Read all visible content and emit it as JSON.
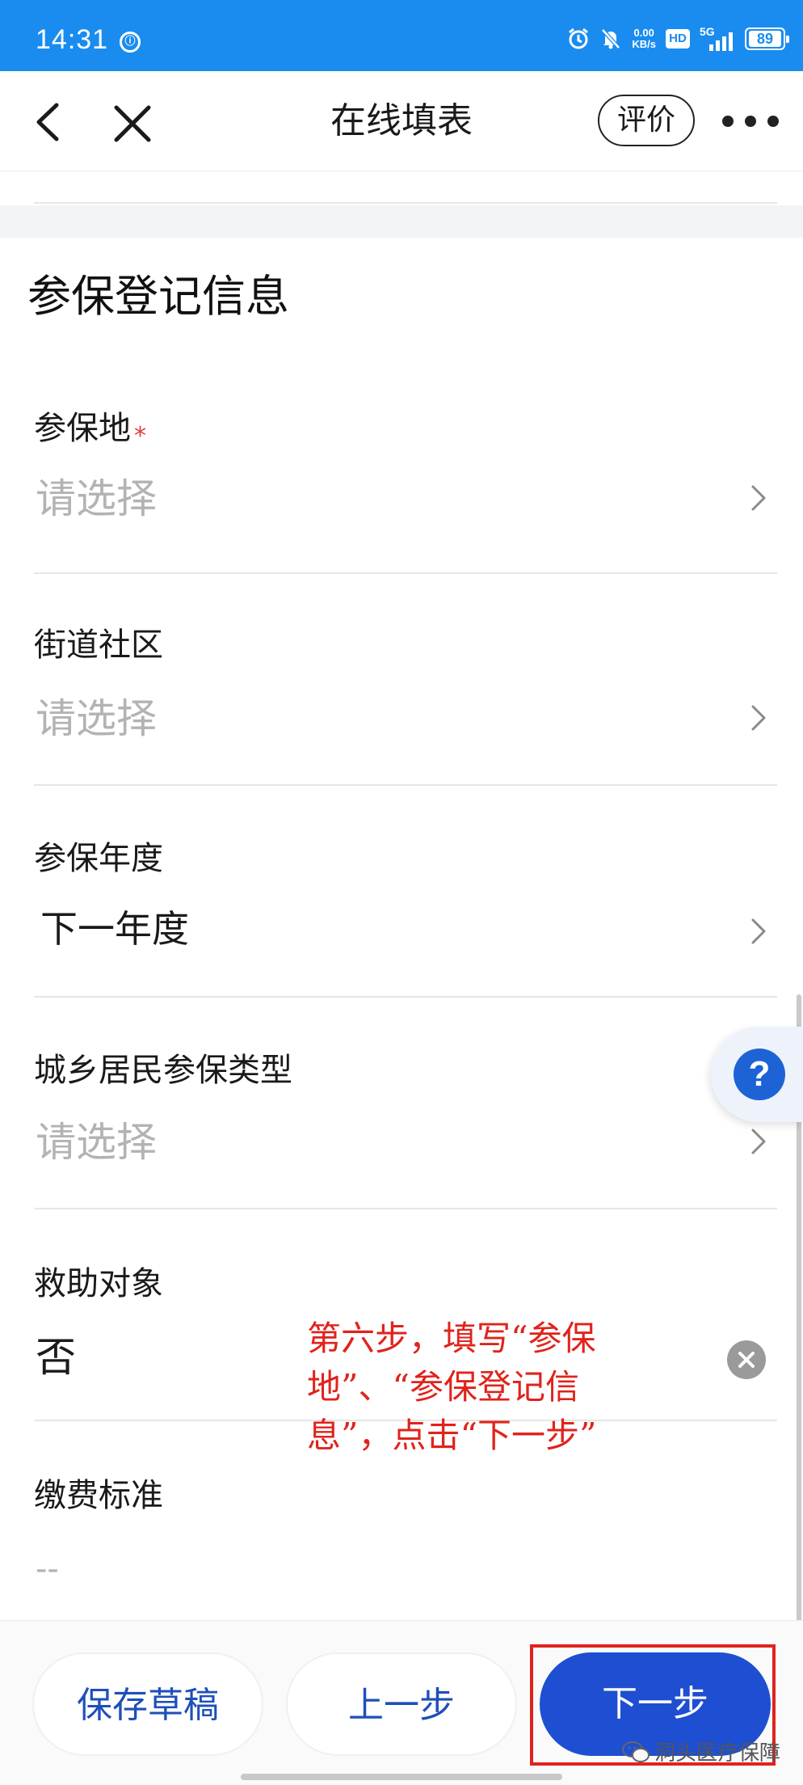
{
  "status_bar": {
    "time": "14:31",
    "net_speed_value": "0.00",
    "net_speed_unit": "KB/s",
    "hd": "HD",
    "network": "5G",
    "battery": "89"
  },
  "nav": {
    "title": "在线填表",
    "rate_label": "评价"
  },
  "section": {
    "title": "参保登记信息"
  },
  "fields": [
    {
      "label": "参保地",
      "required_mark": "*",
      "value": "请选择"
    },
    {
      "label": "街道社区",
      "value": "请选择"
    },
    {
      "label": "参保年度",
      "value": "下一年度"
    },
    {
      "label": "城乡居民参保类型",
      "value": "请选择"
    },
    {
      "label": "救助对象",
      "value": "否"
    },
    {
      "label": "缴费标准",
      "value": "--"
    }
  ],
  "help_fab": {
    "symbol": "?"
  },
  "annotation": {
    "text": "第六步，填写“参保地”、“参保登记信息”，点击“下一步”"
  },
  "footer": {
    "save_draft": "保存草稿",
    "prev": "上一步",
    "next": "下一步"
  },
  "watermark": {
    "text": "洞头医疗保障"
  },
  "colors": {
    "status_bar": "#1a8cf0",
    "primary": "#1e4fd2",
    "annotation": "#e0231c",
    "placeholder": "#b3b3b3"
  }
}
